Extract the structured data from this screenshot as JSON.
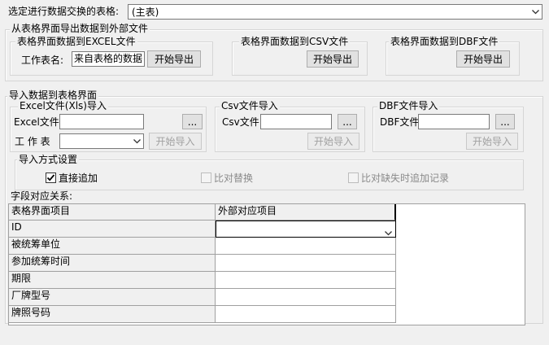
{
  "top": {
    "select_label": "选定进行数据交换的表格:",
    "select_value": "(主表)"
  },
  "export_group": {
    "title": "从表格界面导出数据到外部文件",
    "excel": {
      "title": "表格界面数据到EXCEL文件",
      "sheet_label": "工作表名:",
      "sheet_value": "来自表格的数据",
      "button": "开始导出"
    },
    "csv": {
      "title": "表格界面数据到CSV文件",
      "button": "开始导出"
    },
    "dbf": {
      "title": "表格界面数据到DBF文件",
      "button": "开始导出"
    }
  },
  "import_group": {
    "title": "导入数据到表格界面",
    "excel": {
      "title": "Excel文件(Xls)导入",
      "file_label": "Excel文件",
      "file_value": "",
      "browse": "...",
      "sheet_label": "工 作 表",
      "sheet_value": "",
      "button": "开始导入"
    },
    "csv": {
      "title": "Csv文件导入",
      "file_label": "Csv文件",
      "file_value": "",
      "browse": "...",
      "button": "开始导入"
    },
    "dbf": {
      "title": "DBF文件导入",
      "file_label": "DBF文件",
      "file_value": "",
      "browse": "...",
      "button": "开始导入"
    },
    "mode": {
      "title": "导入方式设置",
      "options": [
        {
          "label": "直接追加",
          "checked": true,
          "enabled": true
        },
        {
          "label": "比对替换",
          "checked": false,
          "enabled": false
        },
        {
          "label": "比对缺失时追加记录",
          "checked": false,
          "enabled": false
        }
      ]
    }
  },
  "mapping": {
    "label": "字段对应关系:",
    "headers": [
      "表格界面项目",
      "外部对应项目"
    ],
    "rows": [
      {
        "field": "ID",
        "external": ""
      },
      {
        "field": "被统筹单位",
        "external": ""
      },
      {
        "field": "参加统筹时间",
        "external": ""
      },
      {
        "field": "期限",
        "external": ""
      },
      {
        "field": "厂牌型号",
        "external": ""
      },
      {
        "field": "牌照号码",
        "external": ""
      }
    ]
  },
  "icons": {
    "dropdown": "chevron-down-icon",
    "checkbox_checked": "check-icon"
  },
  "colors": {
    "window_bg": "#f0f0f0",
    "border": "#a0a0a0",
    "disabled_text": "#a0a0a0"
  }
}
